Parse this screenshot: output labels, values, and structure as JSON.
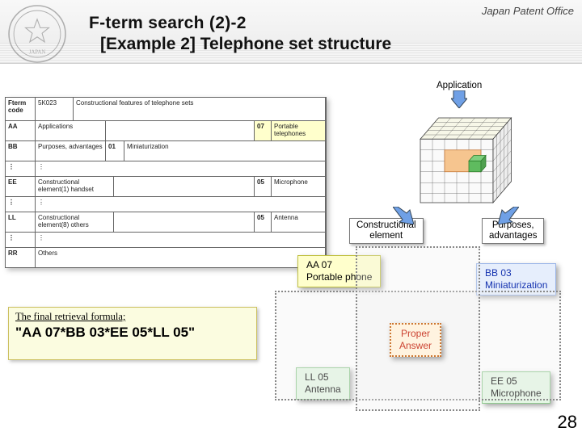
{
  "header": {
    "org": "Japan Patent Office",
    "title_line1": "F-term search (2)-2",
    "title_line2": "[Example 2] Telephone set structure"
  },
  "table": {
    "header_text": "Constructional features of telephone sets",
    "theme_code": "5K023",
    "code_col": "Fterm code",
    "rows": {
      "aa": {
        "code": "AA",
        "desc": "Applications",
        "code07": "07",
        "val07": "Portable telephones"
      },
      "bb": {
        "code": "BB",
        "desc": "Purposes, advantages",
        "code01": "01",
        "desc01": "Miniaturization"
      },
      "ee": {
        "code": "EE",
        "desc": "Constructional element(1) handset",
        "code05": "05",
        "val05": "Microphone"
      },
      "ll": {
        "code": "LL",
        "desc": "Constructional element(8) others",
        "code05": "05",
        "val05": "Antenna"
      },
      "rr": {
        "code": "RR",
        "desc": "Others"
      }
    }
  },
  "axes": {
    "top": "Application",
    "left": "Constructional\nelement",
    "right": "Purposes,\nadvantages"
  },
  "callouts": {
    "aa07": {
      "code": "AA 07",
      "text": "Portable phone"
    },
    "bb03": {
      "code": "BB 03",
      "text": "Miniaturization"
    },
    "ee05": {
      "code": "EE 05",
      "text": "Microphone"
    },
    "ll05": {
      "code": "LL 05",
      "text": "Antenna"
    },
    "proper": "Proper\nAnswer"
  },
  "retrieval": {
    "label": "The final retrieval formula;",
    "formula": "\"AA 07*BB 03*EE 05*LL 05\""
  },
  "page_number": "28"
}
